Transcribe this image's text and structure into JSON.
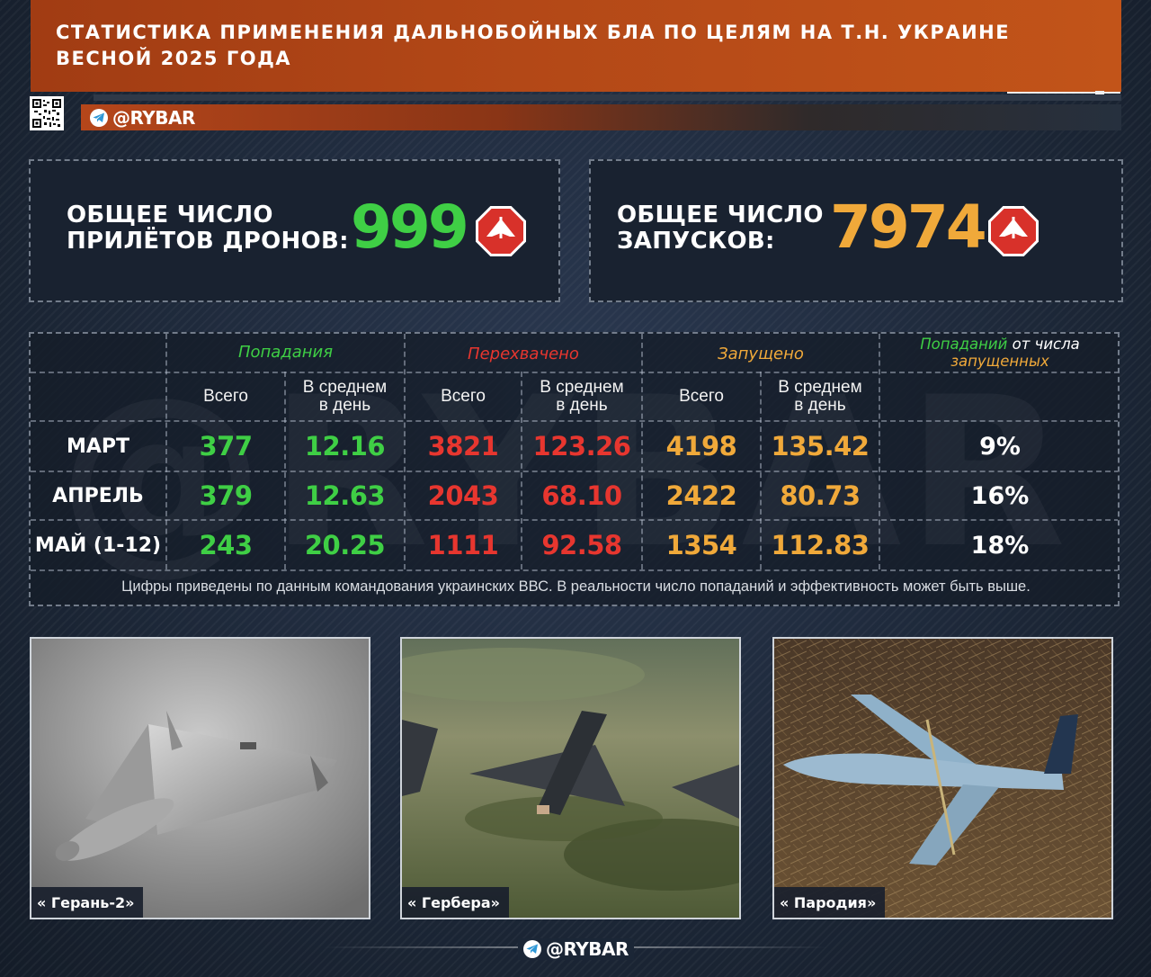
{
  "header": {
    "title_line1": "СТАТИСТИКА ПРИМЕНЕНИЯ ДАЛЬНОБОЙНЫХ БЛА ПО ЦЕЛЯМ НА Т.Н. УКРАИНЕ",
    "title_line2": "ВЕСНОЙ 2025 ГОДА",
    "brand": "@RYBAR",
    "accent_color": "#b34817"
  },
  "stats": {
    "hits": {
      "label_line1": "ОБЩЕЕ ЧИСЛО",
      "label_line2": "ПРИЛЁТОВ ДРОНОВ:",
      "value": "999",
      "color": "#3fcf45",
      "icon": "drone-warning-icon"
    },
    "launches": {
      "label_line1": "ОБЩЕЕ ЧИСЛО",
      "label_line2": "ЗАПУСКОВ:",
      "value": "7974",
      "color": "#f0a93a",
      "icon": "drone-warning-icon"
    }
  },
  "table": {
    "groups": {
      "hits": "Попадания",
      "intercepted": "Перехвачено",
      "launched": "Запущено",
      "ratio_part1": "Попаданий",
      "ratio_part2": " от числа",
      "ratio_part3": "запущенных"
    },
    "subheaders": {
      "total": "Всего",
      "avg_line1": "В среднем",
      "avg_line2": "в день"
    },
    "rows": [
      {
        "label": "МАРТ",
        "hits_total": "377",
        "hits_avg": "12.16",
        "int_total": "3821",
        "int_avg": "123.26",
        "launch_total": "4198",
        "launch_avg": "135.42",
        "ratio": "9%"
      },
      {
        "label": "АПРЕЛЬ",
        "hits_total": "379",
        "hits_avg": "12.63",
        "int_total": "2043",
        "int_avg": "68.10",
        "launch_total": "2422",
        "launch_avg": "80.73",
        "ratio": "16%"
      },
      {
        "label": "МАЙ (1-12)",
        "hits_total": "243",
        "hits_avg": "20.25",
        "int_total": "1111",
        "int_avg": "92.58",
        "launch_total": "1354",
        "launch_avg": "112.83",
        "ratio": "18%"
      }
    ],
    "footnote": "Цифры приведены по данным командования украинских ВВС. В реальности число попаданий и эффективность может быть выше.",
    "watermark": "@RYBAR",
    "colors": {
      "hits": "#3fcf45",
      "intercepted": "#e7362f",
      "launched": "#f0a93a"
    }
  },
  "photos": [
    {
      "caption": "« Герань-2»"
    },
    {
      "caption": "« Гербера»"
    },
    {
      "caption": "« Пародия»"
    }
  ],
  "footer": {
    "brand": "@RYBAR"
  }
}
